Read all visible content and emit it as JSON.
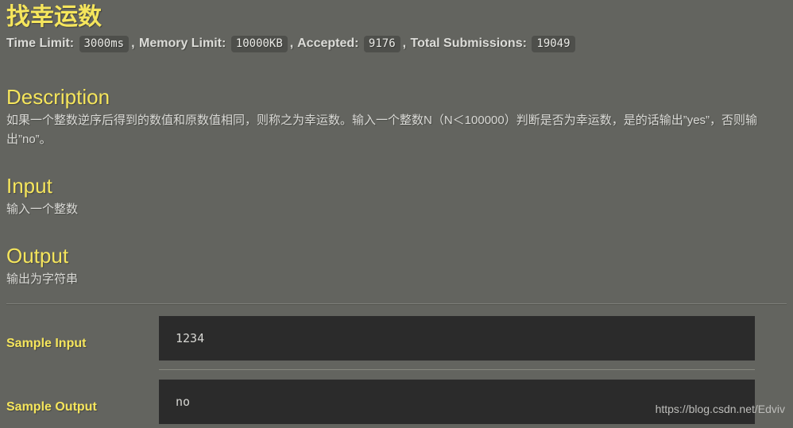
{
  "problem": {
    "title": "找幸运数",
    "meta": {
      "time_limit_label": "Time Limit:",
      "time_limit_value": "3000ms",
      "memory_limit_label": "Memory Limit:",
      "memory_limit_value": "10000KB",
      "accepted_label": "Accepted:",
      "accepted_value": "9176",
      "total_submissions_label": "Total Submissions:",
      "total_submissions_value": "19049",
      "comma": ","
    },
    "sections": {
      "description_heading": "Description",
      "description_text": "如果一个整数逆序后得到的数值和原数值相同，则称之为幸运数。输入一个整数N（N＜100000）判断是否为幸运数，是的话输出”yes”，否则输出”no”。",
      "input_heading": "Input",
      "input_text": "输入一个整数",
      "output_heading": "Output",
      "output_text": "输出为字符串"
    },
    "samples": {
      "input_label": "Sample Input",
      "input_value": "1234",
      "output_label": "Sample Output",
      "output_value": "no"
    }
  },
  "watermark": {
    "text": "https://blog.csdn.net/Edviv"
  },
  "colors": {
    "background": "#63645f",
    "accent_yellow": "#f5e55c",
    "body_text": "#d9d9d5",
    "code_background": "#2b2b2b",
    "badge_background": "#4e4f4b"
  }
}
